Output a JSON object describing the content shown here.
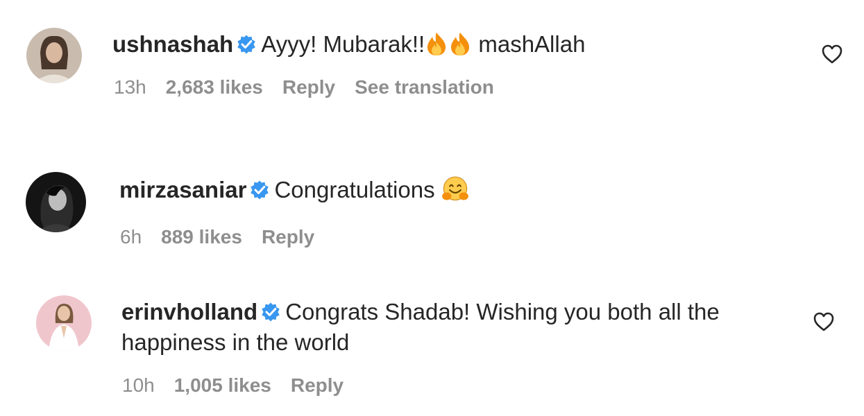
{
  "comments": [
    {
      "username": "ushnashah",
      "text_before": "Ayyy! Mubarak!!",
      "emojis": [
        "fire-emoji",
        "fire-emoji"
      ],
      "text_after": " mashAllah",
      "time": "13h",
      "likes": "2,683 likes",
      "reply": "Reply",
      "translation": "See translation",
      "avatar_color": "#b7a79a"
    },
    {
      "username": "mirzasaniar",
      "text_before": "Congratulations ",
      "emojis": [
        "hugging-face-emoji"
      ],
      "text_after": "",
      "time": "6h",
      "likes": "889 likes",
      "reply": "Reply",
      "avatar_color": "#1c1c1c"
    },
    {
      "username": "erinvholland",
      "text": "Congrats Shadab! Wishing you both all the happiness in the world",
      "time": "10h",
      "likes": "1,005 likes",
      "reply": "Reply",
      "avatar_color": "#f2c9cf"
    }
  ],
  "colors": {
    "primary_text": "#262626",
    "secondary_text": "#8e8e8e",
    "verified_badge": "#3897f0"
  },
  "icons": {
    "verified": "verified-badge-icon",
    "like": "heart-outline-icon"
  }
}
